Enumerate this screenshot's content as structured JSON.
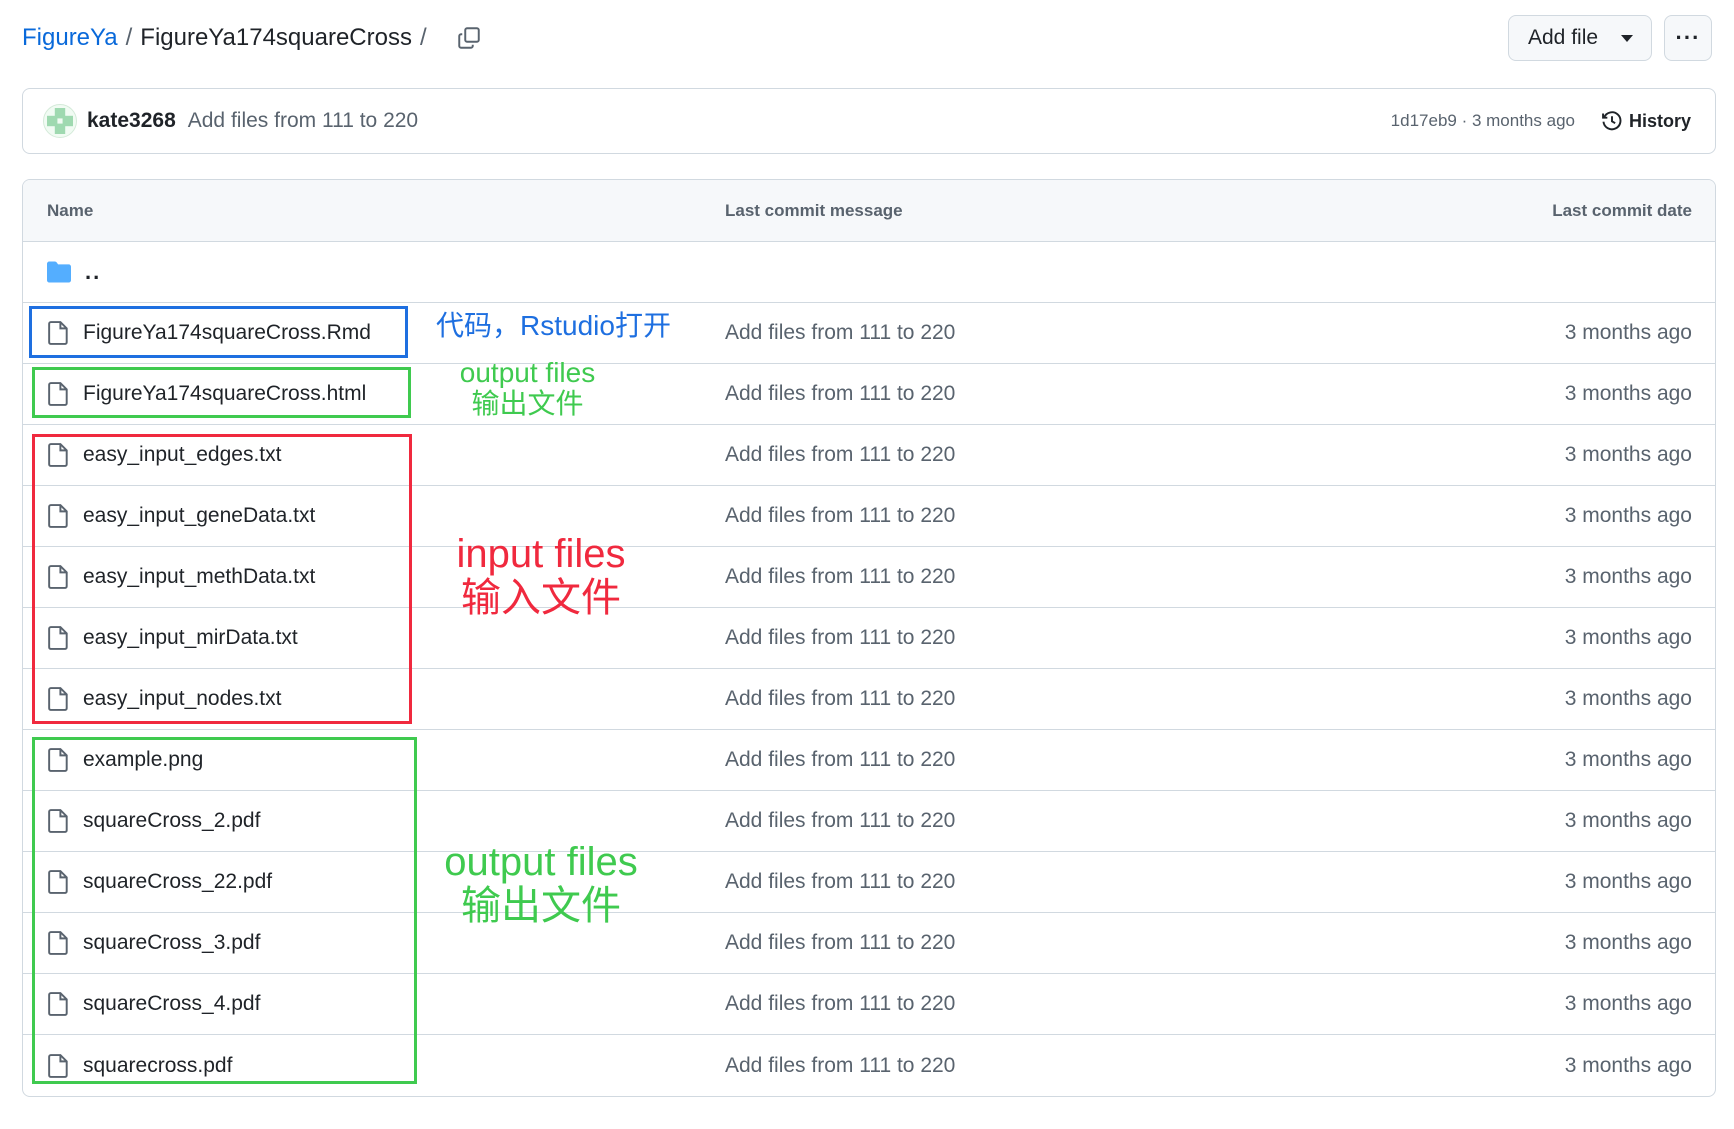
{
  "breadcrumb": {
    "owner": "FigureYa",
    "separator": "/",
    "repo": "FigureYa174squareCross",
    "trailing": "/"
  },
  "actions": {
    "add_file": "Add file",
    "more": "···"
  },
  "latest_commit": {
    "author": "kate3268",
    "message": "Add files from 111 to 220",
    "meta": "1d17eb9 · 3 months ago",
    "history": "History"
  },
  "table": {
    "headers": {
      "name": "Name",
      "message": "Last commit message",
      "date": "Last commit date"
    },
    "parent_dir": "..",
    "files": [
      {
        "name": "FigureYa174squareCross.Rmd",
        "message": "Add files from 111 to 220",
        "date": "3 months ago"
      },
      {
        "name": "FigureYa174squareCross.html",
        "message": "Add files from 111 to 220",
        "date": "3 months ago"
      },
      {
        "name": "easy_input_edges.txt",
        "message": "Add files from 111 to 220",
        "date": "3 months ago"
      },
      {
        "name": "easy_input_geneData.txt",
        "message": "Add files from 111 to 220",
        "date": "3 months ago"
      },
      {
        "name": "easy_input_methData.txt",
        "message": "Add files from 111 to 220",
        "date": "3 months ago"
      },
      {
        "name": "easy_input_mirData.txt",
        "message": "Add files from 111 to 220",
        "date": "3 months ago"
      },
      {
        "name": "easy_input_nodes.txt",
        "message": "Add files from 111 to 220",
        "date": "3 months ago"
      },
      {
        "name": "example.png",
        "message": "Add files from 111 to 220",
        "date": "3 months ago"
      },
      {
        "name": "squareCross_2.pdf",
        "message": "Add files from 111 to 220",
        "date": "3 months ago"
      },
      {
        "name": "squareCross_22.pdf",
        "message": "Add files from 111 to 220",
        "date": "3 months ago"
      },
      {
        "name": "squareCross_3.pdf",
        "message": "Add files from 111 to 220",
        "date": "3 months ago"
      },
      {
        "name": "squareCross_4.pdf",
        "message": "Add files from 111 to 220",
        "date": "3 months ago"
      },
      {
        "name": "squarecross.pdf",
        "message": "Add files from 111 to 220",
        "date": "3 months ago"
      }
    ]
  },
  "annotations": {
    "code": {
      "text": "代码，Rstudio打开",
      "color": "#1e6fe0"
    },
    "output_small": {
      "line1": "output files",
      "line2": "输出文件",
      "color": "#3fca4f"
    },
    "input": {
      "line1": "input files",
      "line2": "输入文件",
      "color": "#f0293e"
    },
    "output_large": {
      "line1": "output files",
      "line2": "输出文件",
      "color": "#3fca4f"
    }
  },
  "colors": {
    "link": "#0969da",
    "folder": "#54aeff",
    "muted": "#59636e",
    "border": "#d1d9e0"
  }
}
